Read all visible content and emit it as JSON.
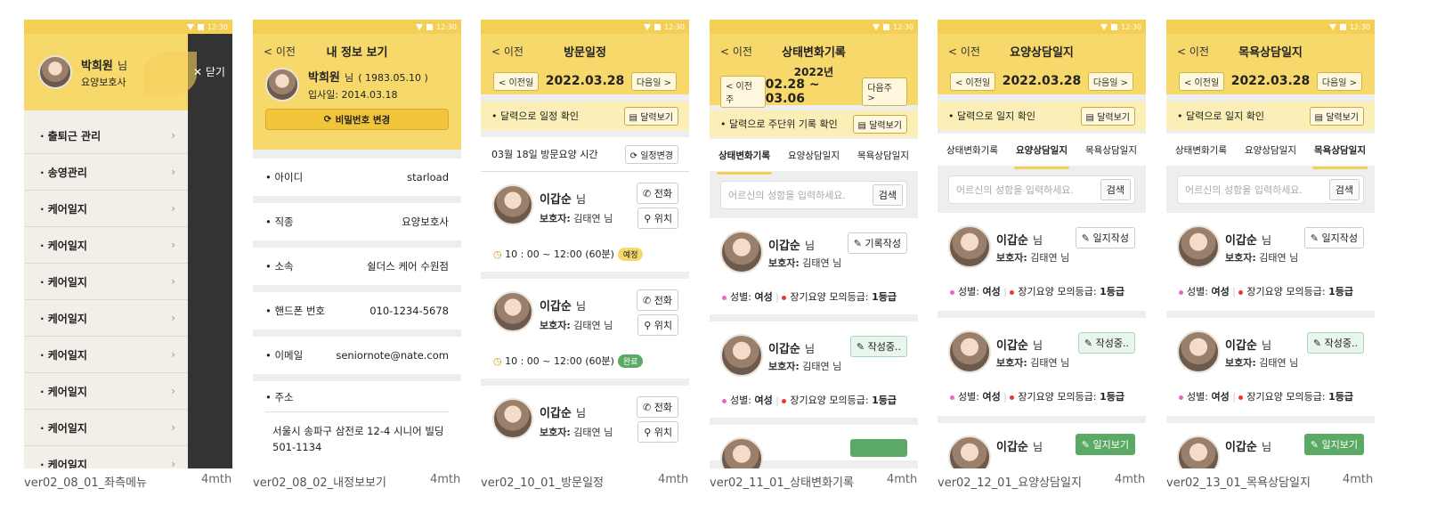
{
  "status": {
    "time": "12:30"
  },
  "captions": [
    {
      "label": "ver02_08_01_좌측메뉴",
      "right": "4mth"
    },
    {
      "label": "ver02_08_02_내정보보기",
      "right": "4mth"
    },
    {
      "label": "ver02_10_01_방문일정",
      "right": "4mth"
    },
    {
      "label": "ver02_11_01_상태변화기록",
      "right": "4mth"
    },
    {
      "label": "ver02_12_01_요양상담일지",
      "right": "4mth"
    },
    {
      "label": "ver02_13_01_목욕상담일지",
      "right": "4mth"
    }
  ],
  "menu": {
    "user_name": "박희원",
    "user_suffix": "님",
    "user_role": "요양보호사",
    "close_label": "닫기",
    "items": [
      "· 출퇴근 관리",
      "· 송영관리",
      "· 케어일지",
      "· 케어일지",
      "· 케어일지",
      "· 케어일지",
      "· 케어일지",
      "· 케어일지",
      "· 케어일지",
      "· 케어일지"
    ]
  },
  "profile": {
    "back": "< 이전",
    "title": "내 정보 보기",
    "name": "박희원",
    "suffix": "님",
    "birth": "( 1983.05.10 )",
    "join": "입사일: 2014.03.18",
    "pw_button": "비밀번호 변경",
    "fields": [
      {
        "label": "• 아이디",
        "value": "starload"
      },
      {
        "label": "• 직종",
        "value": "요양보호사"
      },
      {
        "label": "• 소속",
        "value": "쉴더스 케어 수원점"
      },
      {
        "label": "• 핸드폰 번호",
        "value": "010-1234-5678"
      },
      {
        "label": "• 이메일",
        "value": "seniornote@nate.com"
      }
    ],
    "address_label": "• 주소",
    "address": "서울시 송파구 삼전로 12-4 시니어 빌딩 501-1134"
  },
  "visit": {
    "back": "< 이전",
    "title": "방문일정",
    "prev": "< 이전일",
    "date": "2022.03.28",
    "next": "다음일 >",
    "cal_text": "• 달력으로 일정 확인",
    "cal_btn": "달력보기",
    "section": "03월 18일 방문요양 시간",
    "change_btn": "일정변경",
    "cards": [
      {
        "name": "이갑순",
        "suffix": "님",
        "guardian_label": "보호자:",
        "guardian": "김태연 님",
        "call": "전화",
        "loc": "위치",
        "time": "10 : 00 ~ 12:00 (60분)",
        "badge": "예정"
      },
      {
        "name": "이갑순",
        "suffix": "님",
        "guardian_label": "보호자:",
        "guardian": "김태연 님",
        "call": "전화",
        "loc": "위치",
        "time": "10 : 00 ~ 12:00 (60분)",
        "badge": "완료"
      },
      {
        "name": "이갑순",
        "suffix": "님",
        "guardian_label": "보호자:",
        "guardian": "김태연 님",
        "call": "전화",
        "loc": "위치"
      }
    ]
  },
  "state": {
    "back": "< 이전",
    "title": "상태변화기록",
    "year": "2022년",
    "prev": "< 이전주",
    "range": "02.28 ~ 03.06",
    "next": "다음주 >",
    "cal_text": "• 달력으로 주단위 기록 확인",
    "cal_btn": "달력보기",
    "tabs": [
      "상태변화기록",
      "요양상담일지",
      "목욕상담일지"
    ],
    "search_placeholder": "어르신의 성함을 입력하세요.",
    "search_btn": "검색",
    "cards": [
      {
        "name": "이갑순",
        "suffix": "님",
        "guardian_label": "보호자:",
        "guardian": "김태연 님",
        "btn": "기록작성",
        "gender_label": "성별:",
        "gender": "여성",
        "grade_label": "장기요양 모의등급:",
        "grade": "1등급"
      },
      {
        "name": "이갑순",
        "suffix": "님",
        "guardian_label": "보호자:",
        "guardian": "김태연 님",
        "btn": "작성중..",
        "gender_label": "성별:",
        "gender": "여성",
        "grade_label": "장기요양 모의등급:",
        "grade": "1등급"
      }
    ]
  },
  "care": {
    "back": "< 이전",
    "title": "요양상담일지",
    "prev": "< 이전일",
    "date": "2022.03.28",
    "next": "다음일 >",
    "cal_text": "• 달력으로 일지 확인",
    "cal_btn": "달력보기",
    "tabs": [
      "상태변화기록",
      "요양상담일지",
      "목욕상담일지"
    ],
    "search_placeholder": "어르신의 성함을 입력하세요.",
    "search_btn": "검색",
    "cards": [
      {
        "name": "이갑순",
        "suffix": "님",
        "guardian_label": "보호자:",
        "guardian": "김태연 님",
        "btn": "일지작성",
        "gender_label": "성별:",
        "gender": "여성",
        "grade_label": "장기요양 모의등급:",
        "grade": "1등급"
      },
      {
        "name": "이갑순",
        "suffix": "님",
        "guardian_label": "보호자:",
        "guardian": "김태연 님",
        "btn": "작성중..",
        "gender_label": "성별:",
        "gender": "여성",
        "grade_label": "장기요양 모의등급:",
        "grade": "1등급"
      },
      {
        "name": "이갑순",
        "suffix": "님",
        "btn": "일지보기"
      }
    ]
  },
  "bath": {
    "back": "< 이전",
    "title": "목욕상담일지",
    "prev": "< 이전일",
    "date": "2022.03.28",
    "next": "다음일 >",
    "cal_text": "• 달력으로 일지 확인",
    "cal_btn": "달력보기",
    "tabs": [
      "상태변화기록",
      "요양상담일지",
      "목욕상담일지"
    ],
    "search_placeholder": "어르신의 성함을 입력하세요.",
    "search_btn": "검색",
    "cards": [
      {
        "name": "이갑순",
        "suffix": "님",
        "guardian_label": "보호자:",
        "guardian": "김태연 님",
        "btn": "일지작성",
        "gender_label": "성별:",
        "gender": "여성",
        "grade_label": "장기요양 모의등급:",
        "grade": "1등급"
      },
      {
        "name": "이갑순",
        "suffix": "님",
        "guardian_label": "보호자:",
        "guardian": "김태연 님",
        "btn": "작성중..",
        "gender_label": "성별:",
        "gender": "여성",
        "grade_label": "장기요양 모의등급:",
        "grade": "1등급"
      },
      {
        "name": "이갑순",
        "suffix": "님",
        "btn": "일지보기"
      }
    ]
  }
}
